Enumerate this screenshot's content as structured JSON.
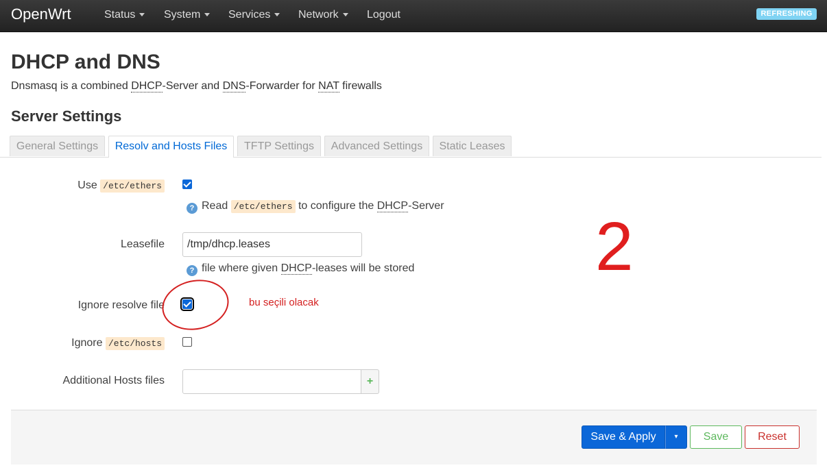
{
  "navbar": {
    "brand": "OpenWrt",
    "items": [
      {
        "label": "Status",
        "has_caret": true
      },
      {
        "label": "System",
        "has_caret": true
      },
      {
        "label": "Services",
        "has_caret": true
      },
      {
        "label": "Network",
        "has_caret": true
      },
      {
        "label": "Logout",
        "has_caret": false
      }
    ],
    "status_badge": "REFRESHING"
  },
  "page": {
    "title": "DHCP and DNS",
    "desc_parts": [
      "Dnsmasq is a combined ",
      "DHCP",
      "-Server and ",
      "DNS",
      "-Forwarder for ",
      "NAT",
      " firewalls"
    ]
  },
  "section": {
    "title": "Server Settings",
    "tabs": [
      {
        "label": "General Settings",
        "active": false
      },
      {
        "label": "Resolv and Hosts Files",
        "active": true
      },
      {
        "label": "TFTP Settings",
        "active": false
      },
      {
        "label": "Advanced Settings",
        "active": false
      },
      {
        "label": "Static Leases",
        "active": false
      }
    ]
  },
  "form": {
    "use_ethers": {
      "label_prefix": "Use",
      "label_code": "/etc/ethers",
      "checked": true,
      "help": {
        "prefix": "Read",
        "code": "/etc/ethers",
        "mid": "to configure the",
        "abbr": "DHCP",
        "suffix": "-Server"
      }
    },
    "leasefile": {
      "label": "Leasefile",
      "value": "/tmp/dhcp.leases",
      "help": {
        "prefix": "file where given",
        "abbr": "DHCP",
        "suffix": "-leases will be stored"
      }
    },
    "ignore_resolve": {
      "label": "Ignore resolve file",
      "checked": true
    },
    "ignore_hosts": {
      "label_prefix": "Ignore",
      "label_code": "/etc/hosts",
      "checked": false
    },
    "additional_hosts": {
      "label": "Additional Hosts files",
      "value": "",
      "add_icon": "+"
    }
  },
  "annotations": {
    "note": "bu seçili olacak",
    "number": "2",
    "color": "#d42020"
  },
  "actions": {
    "save_apply": "Save & Apply",
    "dropdown_icon": "▾",
    "save": "Save",
    "reset": "Reset"
  }
}
